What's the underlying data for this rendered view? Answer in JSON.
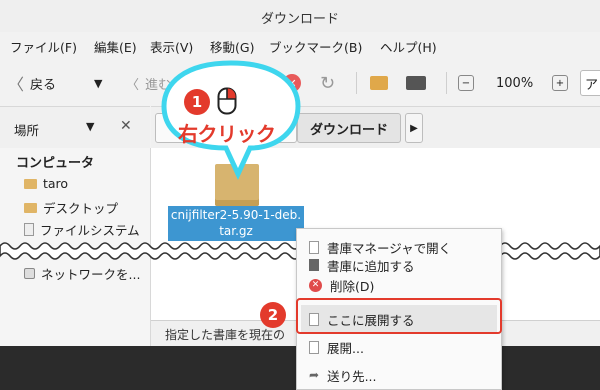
{
  "window": {
    "title": "ダウンロード"
  },
  "menubar": [
    "ファイル(F)",
    "編集(E)",
    "表示(V)",
    "移動(G)",
    "ブックマーク(B)",
    "ヘルプ(H)"
  ],
  "toolbar": {
    "back_label": "戻る",
    "forward_label": "進む",
    "zoom": "100%",
    "location_prefix": "ア"
  },
  "sidebar": {
    "header_label": "場所",
    "section_title": "コンピュータ",
    "items": [
      "taro",
      "デスクトップ",
      "ファイルシステム",
      "ネットワークを..."
    ]
  },
  "pathbar": {
    "current": "ダウンロード"
  },
  "file": {
    "name_line1": "cnijfilter2-5.90-1-deb.",
    "name_line2": "tar.gz"
  },
  "status": {
    "text": "指定した書庫を現在の"
  },
  "context_menu": {
    "items": [
      "書庫マネージャで開く",
      "書庫に追加する",
      "削除(D)",
      "ここに展開する",
      "展開...",
      "送り先..."
    ]
  },
  "annotations": {
    "step1_number": "1",
    "step1_text": "右クリック",
    "step2_number": "2",
    "accent_red": "#e33a2c",
    "callout_cyan": "#3ed6ee"
  }
}
